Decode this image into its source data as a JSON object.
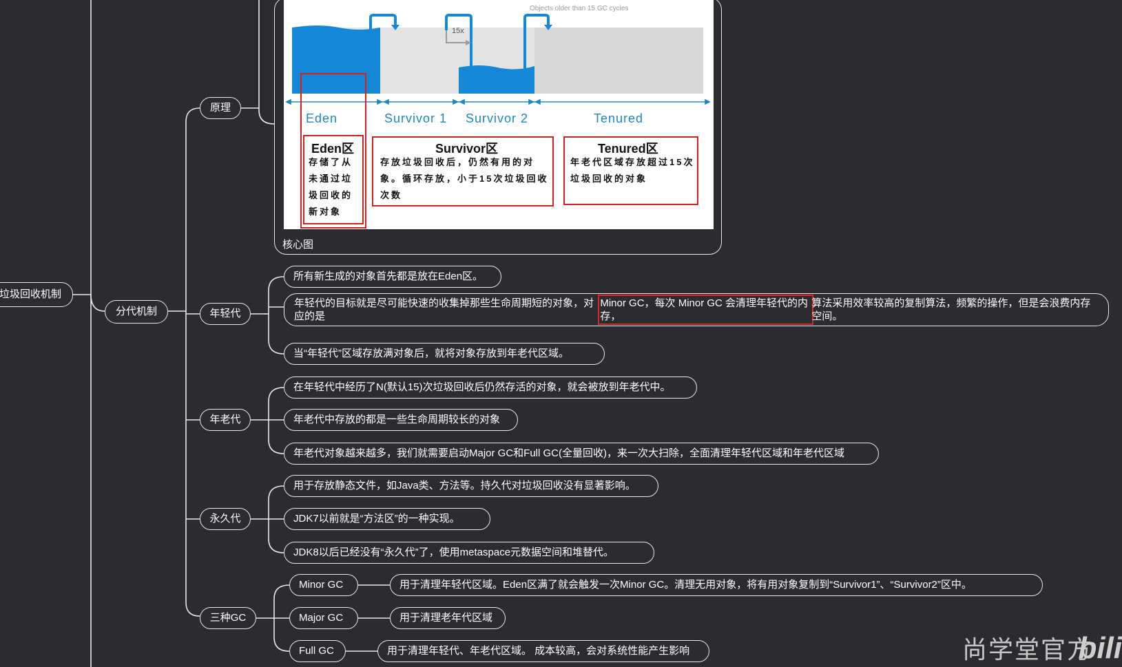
{
  "root": {
    "label": "垃圾回收机制"
  },
  "branch": {
    "label": "分代机制"
  },
  "topics": {
    "principle": "原理",
    "young": "年轻代",
    "old": "年老代",
    "perm": "永久代",
    "gc": "三种GC"
  },
  "figure": {
    "caption": "核心图",
    "top_note": "Objects older than 15 GC cycles",
    "times_label": "15x",
    "regions": [
      "Eden",
      "Survivor 1",
      "Survivor 2",
      "Tenured"
    ],
    "eden_box": {
      "title": "Eden区",
      "text": "存储了从未通过垃圾回收的新对象"
    },
    "survivor_box": {
      "title": "Survivor区",
      "text": "存放垃圾回收后，仍然有用的对象。循环存放，小于15次垃圾回收次数"
    },
    "tenured_box": {
      "title": "Tenured区",
      "text": "年老代区域存放超过15次垃圾回收的对象"
    },
    "colors": {
      "water": "#1487d6",
      "tank": "#e3e3e3",
      "axis": "#1b86c6",
      "highlight": "#d62020"
    }
  },
  "young_items": [
    "所有新生成的对象首先都是放在Eden区。",
    {
      "before": "年轻代的目标就是尽可能快速的收集掉那些生命周期短的对象，对应的是",
      "highlight": "Minor GC，每次 Minor GC 会清理年轻代的内存，",
      "after": "算法采用效率较高的复制算法，频繁的操作，但是会浪费内存空间。"
    },
    "当“年轻代”区域存放满对象后，就将对象存放到年老代区域。"
  ],
  "old_items": [
    "在年轻代中经历了N(默认15)次垃圾回收后仍然存活的对象，就会被放到年老代中。",
    "年老代中存放的都是一些生命周期较长的对象",
    "年老代对象越来越多，我们就需要启动Major GC和Full GC(全量回收)，来一次大扫除，全面清理年轻代区域和年老代区域"
  ],
  "perm_items": [
    "用于存放静态文件，如Java类、方法等。持久代对垃圾回收没有显著影响。",
    "JDK7以前就是“方法区”的一种实现。",
    "JDK8以后已经没有“永久代”了，使用metaspace元数据空间和堆替代。"
  ],
  "gc_types": [
    {
      "name": "Minor GC",
      "desc": "用于清理年轻代区域。Eden区满了就会触发一次Minor GC。清理无用对象，将有用对象复制到“Survivor1”、“Survivor2”区中。"
    },
    {
      "name": "Major GC",
      "desc": "用于清理老年代区域"
    },
    {
      "name": "Full GC",
      "desc": "用于清理年轻代、年老代区域。 成本较高，会对系统性能产生影响"
    }
  ],
  "watermark": {
    "text": "尚学堂官方",
    "logo": "bili"
  },
  "theme": {
    "background": "#2b2c30",
    "line": "#e9e9e9",
    "highlight": "#e02424"
  }
}
